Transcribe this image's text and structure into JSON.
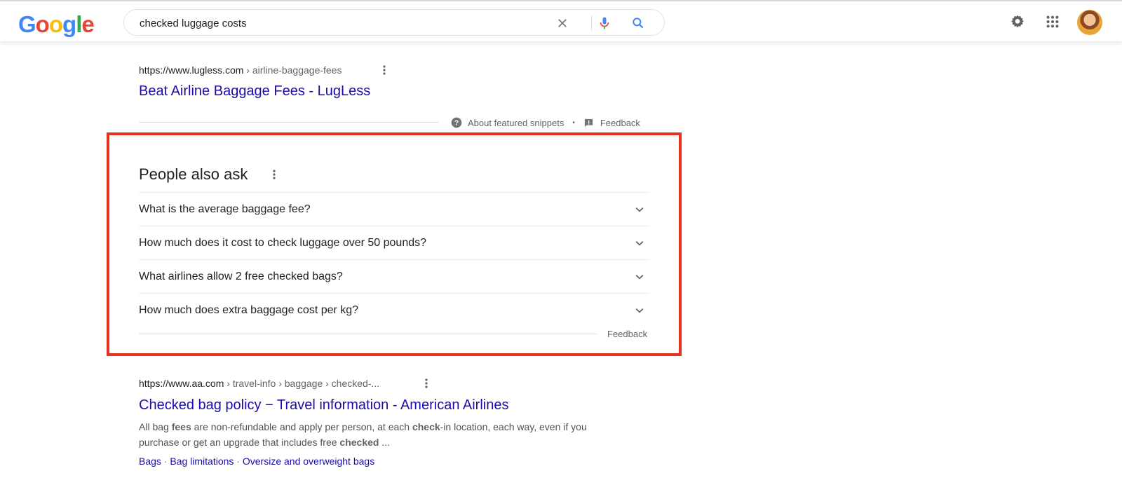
{
  "header": {
    "logo_letters": [
      {
        "char": "G",
        "color": "#4285F4"
      },
      {
        "char": "o",
        "color": "#EA4335"
      },
      {
        "char": "o",
        "color": "#FBBC05"
      },
      {
        "char": "g",
        "color": "#4285F4"
      },
      {
        "char": "l",
        "color": "#34A853"
      },
      {
        "char": "e",
        "color": "#EA4335"
      }
    ],
    "search_query": "checked luggage costs",
    "icons": [
      "clear-icon",
      "microphone-icon",
      "search-icon",
      "gear-icon",
      "apps-grid-icon",
      "avatar"
    ]
  },
  "results": [
    {
      "domain": "https://www.lugless.com",
      "path": " › airline-baggage-fees",
      "title": "Beat Airline Baggage Fees - LugLess"
    },
    {
      "domain": "https://www.aa.com",
      "path": " › travel-info › baggage › checked-...",
      "title": "Checked bag policy − Travel information - American Airlines",
      "snippet_parts": [
        {
          "t": "All bag ",
          "b": false
        },
        {
          "t": "fees",
          "b": true
        },
        {
          "t": " are non-refundable and apply per person, at each ",
          "b": false
        },
        {
          "t": "check",
          "b": true
        },
        {
          "t": "-in location, each way, even if you purchase or get an upgrade that includes free ",
          "b": false
        },
        {
          "t": "checked",
          "b": true
        },
        {
          "t": " ...",
          "b": false
        }
      ],
      "sitelinks": [
        "Bags",
        "Bag limitations",
        "Oversize and overweight bags"
      ],
      "sitelink_separator": " · "
    }
  ],
  "snippet_meta": {
    "about_label": "About featured snippets",
    "separator": "•",
    "feedback_label": "Feedback"
  },
  "people_also_ask": {
    "title": "People also ask",
    "questions": [
      "What is the average baggage fee?",
      "How much does it cost to check luggage over 50 pounds?",
      "What airlines allow 2 free checked bags?",
      "How much does extra baggage cost per kg?"
    ],
    "feedback_label": "Feedback"
  },
  "colors": {
    "link": "#1a0dab",
    "highlight_border": "#e8301f",
    "mic_blue": "#4285F4",
    "mic_red": "#EA4335",
    "search_blue": "#4285F4"
  }
}
